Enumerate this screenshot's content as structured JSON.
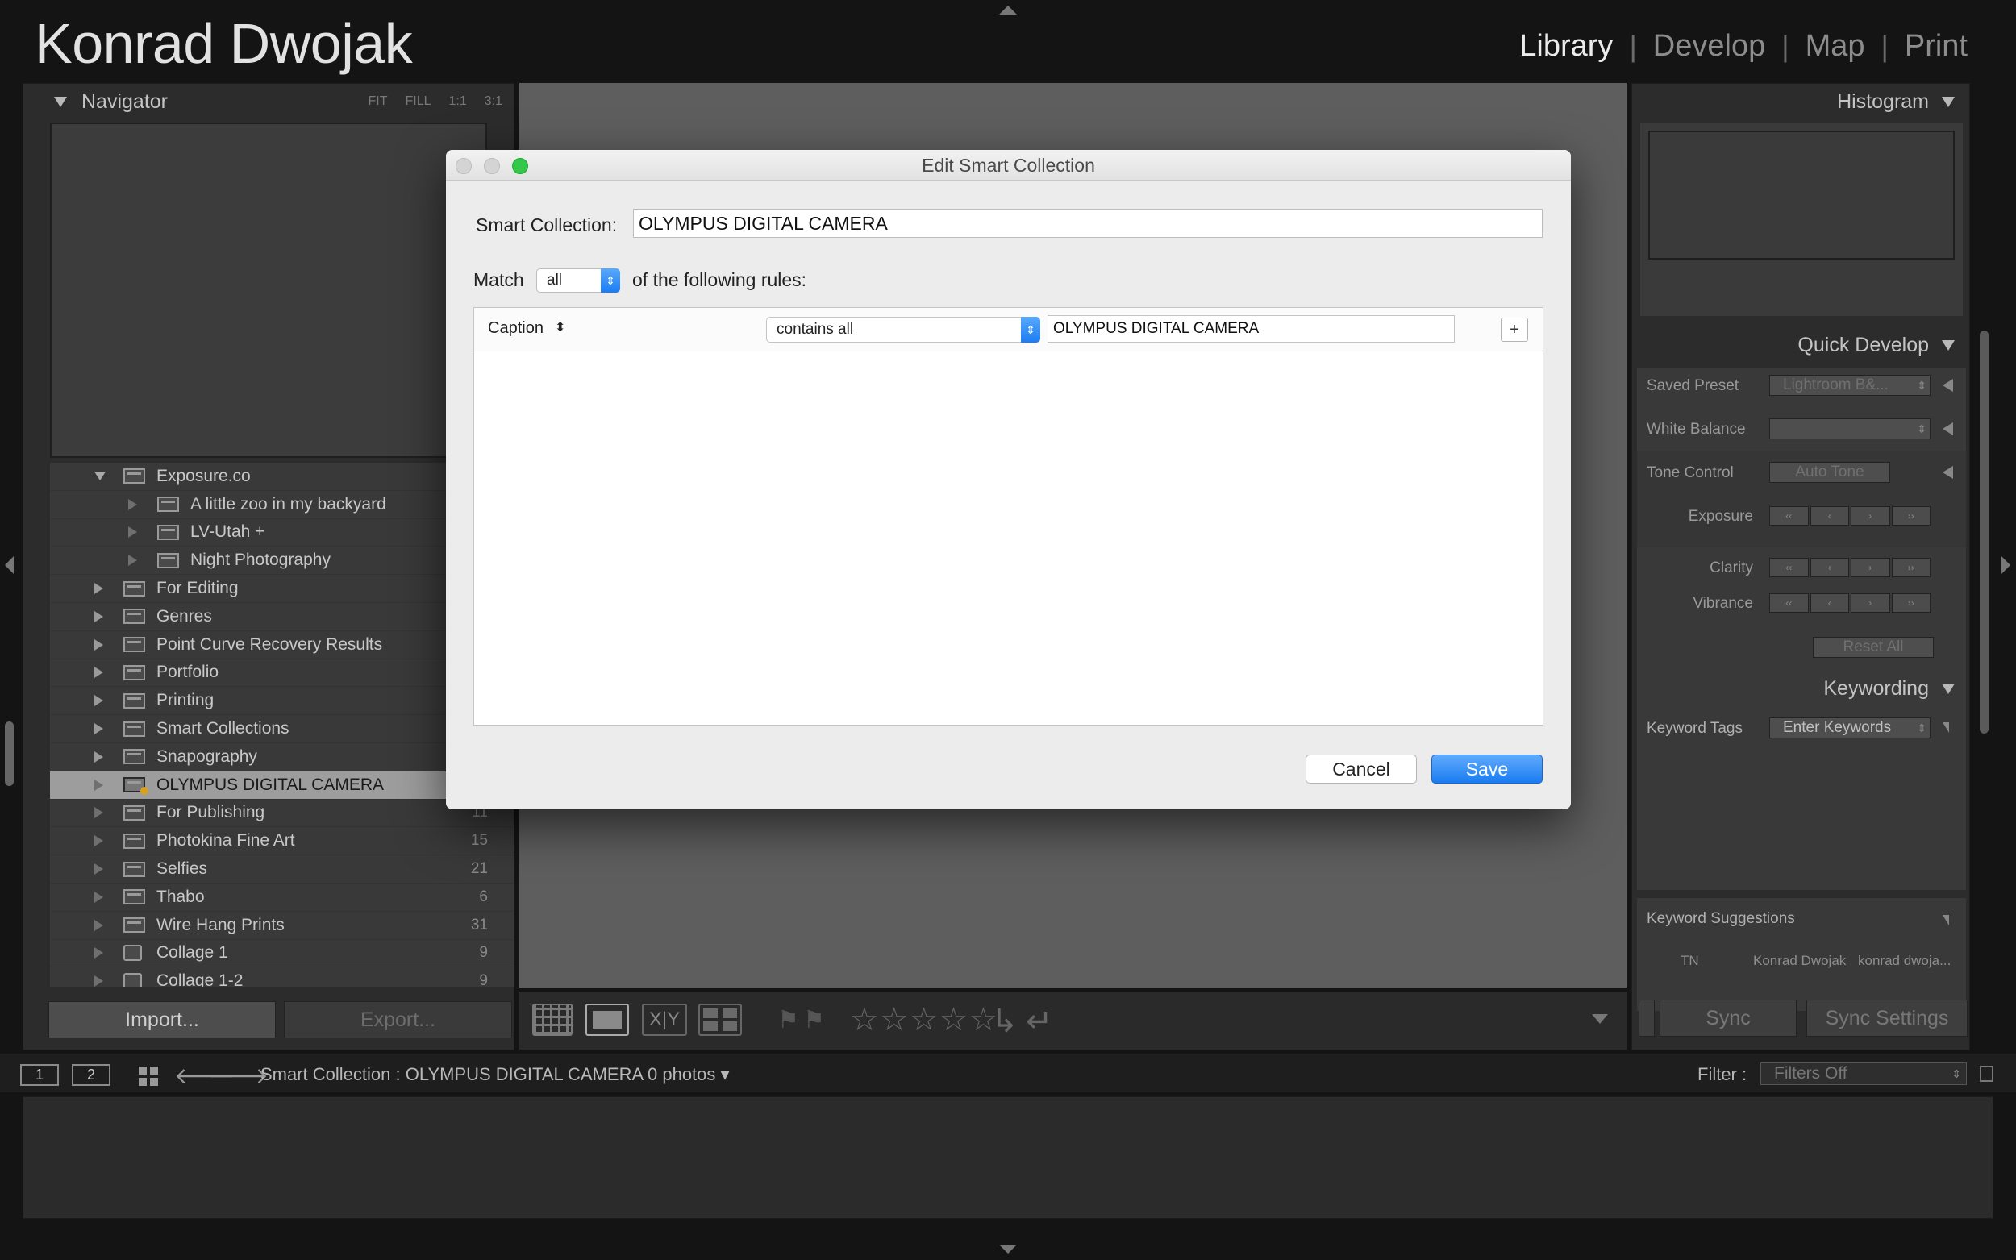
{
  "identity_plate": "Konrad Dwojak",
  "modules": [
    "Library",
    "Develop",
    "Map",
    "Print"
  ],
  "active_module": "Library",
  "navigator": {
    "title": "Navigator",
    "zoom_options": [
      "FIT",
      "FILL",
      "1:1",
      "3:1"
    ]
  },
  "collections": [
    {
      "name": "Exposure.co",
      "level": 0,
      "expander": "open",
      "icon": "collection-set-icon",
      "count": ""
    },
    {
      "name": "A little zoo in my backyard",
      "level": 1,
      "expander": "hollow",
      "icon": "collection-icon",
      "count": ""
    },
    {
      "name": "LV-Utah  +",
      "level": 1,
      "expander": "hollow",
      "icon": "collection-icon",
      "count": ""
    },
    {
      "name": "Night Photography",
      "level": 1,
      "expander": "hollow",
      "icon": "collection-icon",
      "count": ""
    },
    {
      "name": "For Editing",
      "level": 0,
      "expander": "closed",
      "icon": "collection-set-icon",
      "count": ""
    },
    {
      "name": "Genres",
      "level": 0,
      "expander": "closed",
      "icon": "collection-set-icon",
      "count": ""
    },
    {
      "name": "Point Curve Recovery Results",
      "level": 0,
      "expander": "closed",
      "icon": "collection-set-icon",
      "count": ""
    },
    {
      "name": "Portfolio",
      "level": 0,
      "expander": "closed",
      "icon": "collection-set-icon",
      "count": ""
    },
    {
      "name": "Printing",
      "level": 0,
      "expander": "closed",
      "icon": "collection-set-icon",
      "count": ""
    },
    {
      "name": "Smart Collections",
      "level": 0,
      "expander": "closed",
      "icon": "collection-set-icon",
      "count": ""
    },
    {
      "name": "Snapography",
      "level": 0,
      "expander": "closed",
      "icon": "collection-set-icon",
      "count": ""
    },
    {
      "name": "OLYMPUS DIGITAL CAMERA",
      "level": 0,
      "expander": "hollow",
      "icon": "smart-collection-icon",
      "count": "",
      "selected": true
    },
    {
      "name": "For Publishing",
      "level": 0,
      "expander": "hollow",
      "icon": "collection-icon",
      "count": "11"
    },
    {
      "name": "Photokina Fine Art",
      "level": 0,
      "expander": "hollow",
      "icon": "collection-icon",
      "count": "15"
    },
    {
      "name": "Selfies",
      "level": 0,
      "expander": "hollow",
      "icon": "collection-icon",
      "count": "21"
    },
    {
      "name": "Thabo",
      "level": 0,
      "expander": "hollow",
      "icon": "collection-icon",
      "count": "6"
    },
    {
      "name": "Wire Hang Prints",
      "level": 0,
      "expander": "hollow",
      "icon": "collection-icon",
      "count": "31"
    },
    {
      "name": "Collage 1",
      "level": 0,
      "expander": "hollow",
      "icon": "print-icon",
      "count": "9"
    },
    {
      "name": "Collage 1-2",
      "level": 0,
      "expander": "hollow",
      "icon": "print-icon",
      "count": "9"
    }
  ],
  "left_buttons": {
    "import": "Import...",
    "export": "Export..."
  },
  "toolbar": {
    "compare_label": "X|Y",
    "stars": "☆☆☆☆☆",
    "flag_glyph": "⚑",
    "reject_glyph": "⚑",
    "rotate_left": "↳",
    "rotate_right": "↵"
  },
  "right_panel": {
    "histogram": "Histogram",
    "quick_develop": "Quick Develop",
    "saved_preset_label": "Saved Preset",
    "saved_preset_value": "Lightroom B&...",
    "white_balance_label": "White Balance",
    "white_balance_value": "",
    "tone_control_label": "Tone Control",
    "auto_tone": "Auto Tone",
    "exposure_label": "Exposure",
    "clarity_label": "Clarity",
    "vibrance_label": "Vibrance",
    "reset_all": "Reset All",
    "keywording": "Keywording",
    "keyword_tags_label": "Keyword Tags",
    "keyword_tags_value": "Enter Keywords",
    "keyword_suggestions": "Keyword Suggestions",
    "suggestions": [
      "TN",
      "Konrad Dwojak",
      "konrad dwoja..."
    ],
    "step_glyphs": [
      "‹‹",
      "‹",
      "›",
      "››"
    ],
    "sync": "Sync",
    "sync_settings": "Sync Settings"
  },
  "filmstrip": {
    "monitor_1": "1",
    "monitor_2": "2",
    "source": "Smart Collection : OLYMPUS DIGITAL CAMERA",
    "photo_count": "0 photos ▾",
    "filter_label": "Filter :",
    "filter_value": "Filters Off",
    "prev_arrow": "🡐",
    "next_arrow": "🡒"
  },
  "dialog": {
    "title": "Edit Smart Collection",
    "name_label": "Smart Collection:",
    "name_value": "OLYMPUS DIGITAL CAMERA",
    "match_label": "Match",
    "match_value": "all",
    "match_suffix": "of the following rules:",
    "rule_field": "Caption",
    "rule_field_spinner": "⬍",
    "rule_operator": "contains all",
    "rule_value": "OLYMPUS DIGITAL CAMERA",
    "add_rule": "+",
    "spinner_glyph": "⇕",
    "cancel": "Cancel",
    "save": "Save"
  },
  "colors": {
    "accent": "#1a7cf1",
    "app_bg": "#141414",
    "panel_bg": "#2c2c2c",
    "selection": "#9d9d9d"
  }
}
